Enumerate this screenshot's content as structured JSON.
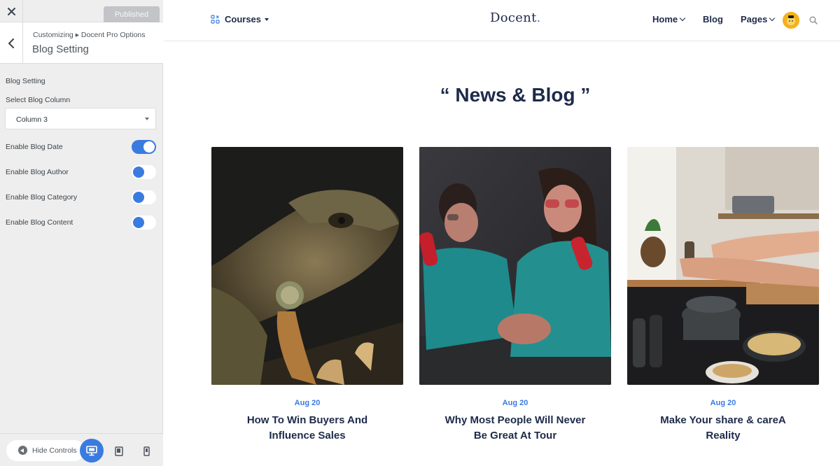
{
  "customizer": {
    "publish_label": "Published",
    "breadcrumb": "Customizing ▸ Docent Pro Options",
    "title": "Blog Setting",
    "section_label": "Blog Setting",
    "column_label": "Select Blog Column",
    "column_value": "Column 3",
    "toggles": [
      {
        "label": "Enable Blog Date",
        "on": true
      },
      {
        "label": "Enable Blog Author",
        "on": false
      },
      {
        "label": "Enable Blog Category",
        "on": false
      },
      {
        "label": "Enable Blog Content",
        "on": false
      }
    ],
    "hide_controls_label": "Hide Controls",
    "accent_color": "#3a7be0"
  },
  "site": {
    "courses_label": "Courses",
    "logo": "Docent",
    "logo_dot": ".",
    "nav": {
      "home": "Home",
      "blog": "Blog",
      "pages": "Pages"
    },
    "section_title": "“ News & Blog ”",
    "posts": [
      {
        "date": "Aug 20",
        "title_line1": "How To Win Buyers And",
        "title_line2": "Influence Sales",
        "image": "iguana-photo"
      },
      {
        "date": "Aug 20",
        "title_line1": "Why Most People Will Never",
        "title_line2": "Be Great At Tour",
        "image": "two-women-soda-photo"
      },
      {
        "date": "Aug 20",
        "title_line1": "Make Your share & careA",
        "title_line2": "Reality",
        "image": "kitchen-cooking-photo"
      }
    ]
  }
}
